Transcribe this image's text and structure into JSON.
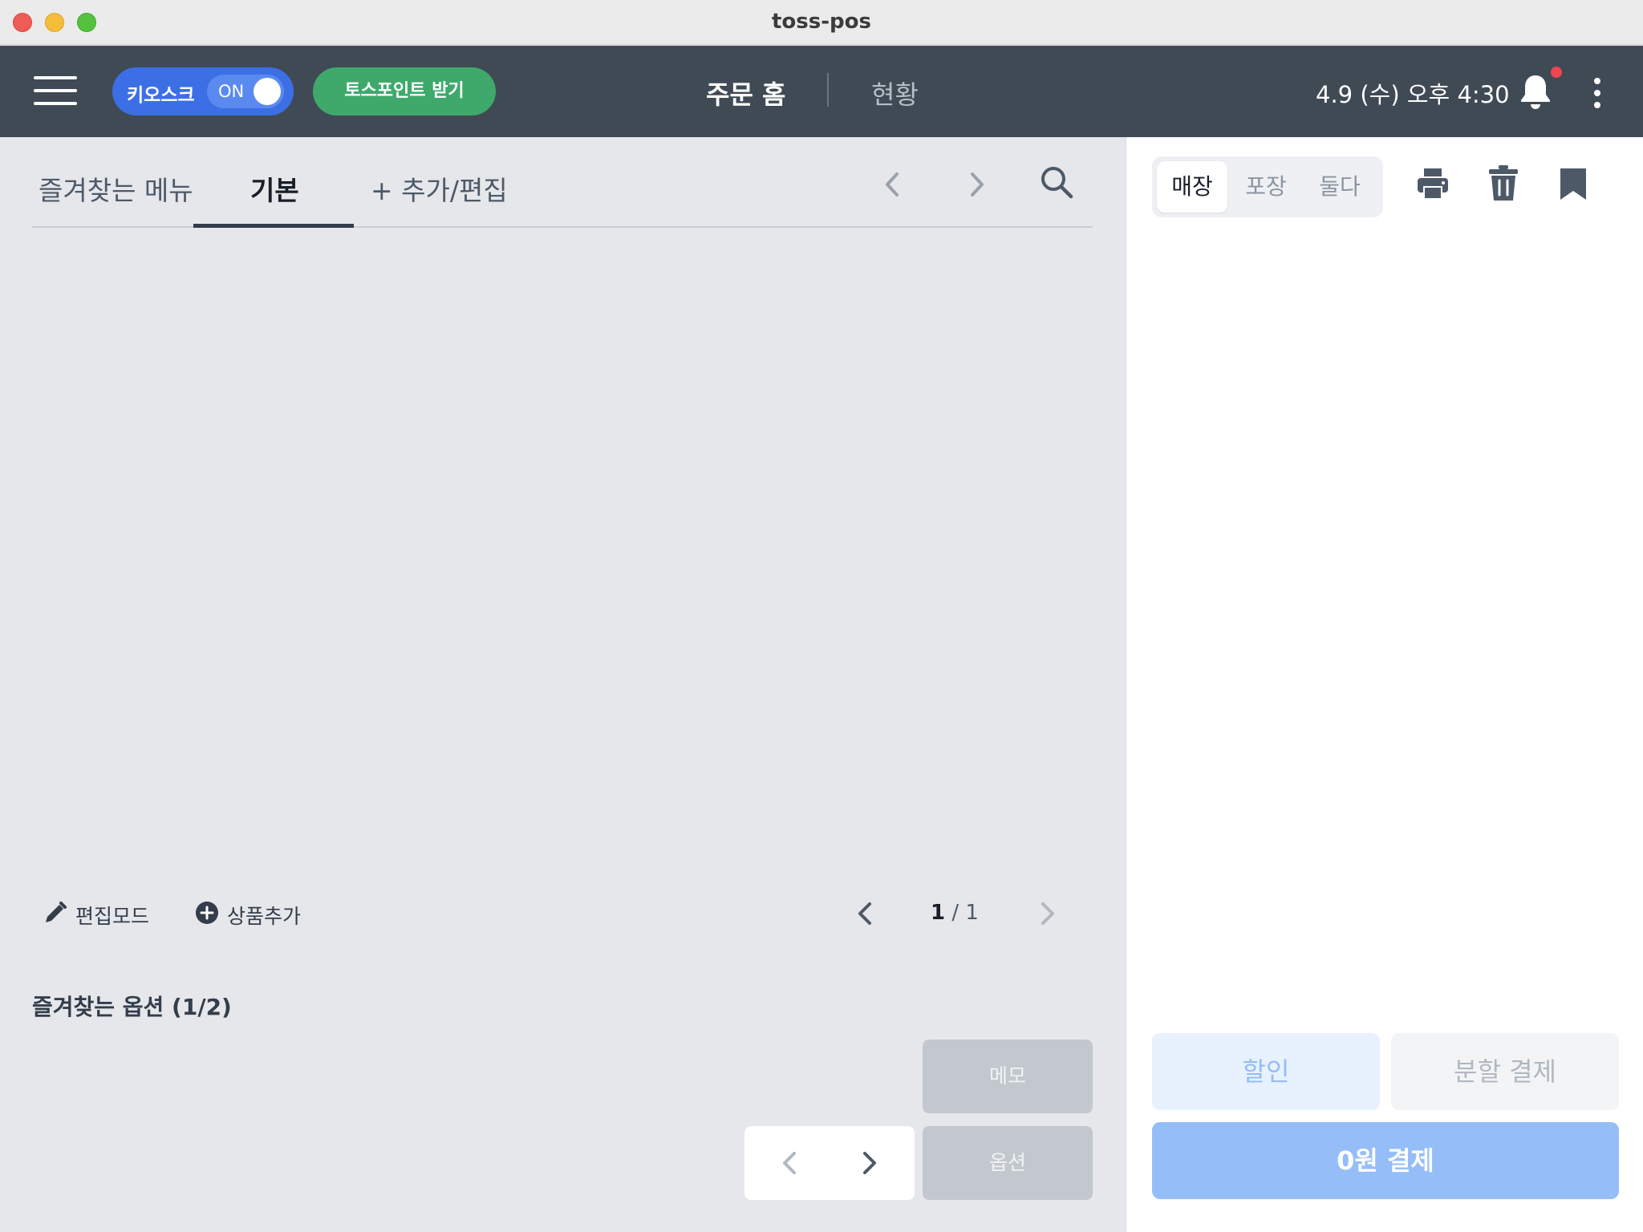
{
  "window": {
    "title": "toss-pos"
  },
  "topbar": {
    "kiosk_label": "키오스크",
    "kiosk_toggle": "ON",
    "points_button": "토스포인트 받기",
    "nav_home": "주문 홈",
    "nav_status": "현황",
    "datetime": "4.9 (수) 오후 4:30"
  },
  "menu_tabs": {
    "favorites": "즐겨찾는 메뉴",
    "basic": "기본",
    "add_edit": "+ 추가/편집",
    "active": "기본"
  },
  "grid_footer": {
    "edit_mode": "편집모드",
    "add_product": "상품추가",
    "page_current": "1",
    "page_separator": " / ",
    "page_total": "1"
  },
  "options": {
    "title": "즐겨찾는 옵션 (1/2)",
    "memo": "메모",
    "option": "옵션"
  },
  "order_panel": {
    "order_types": [
      "매장",
      "포장",
      "둘다"
    ],
    "selected_type": "매장",
    "discount": "할인",
    "split_payment": "분할 결제",
    "pay": "0원 결제"
  },
  "colors": {
    "topbar": "#3f4a55",
    "kiosk_blue": "#3c6fe6",
    "points_green": "#3fa96b",
    "pay_blue": "#95bef8",
    "notification_dot": "#ef4452"
  },
  "icons": [
    "hamburger-icon",
    "chevron-left-icon",
    "chevron-right-icon",
    "search-icon",
    "pencil-icon",
    "plus-circle-icon",
    "bell-icon",
    "more-vertical-icon",
    "printer-icon",
    "trash-icon",
    "bookmark-icon"
  ]
}
